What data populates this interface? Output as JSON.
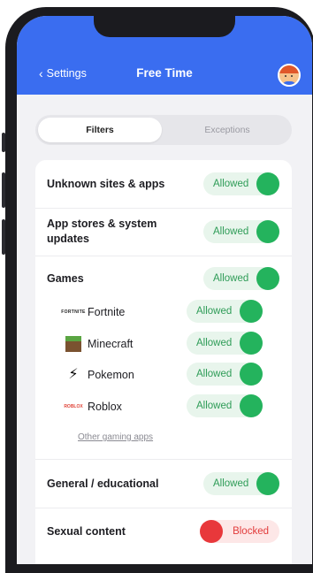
{
  "header": {
    "back_label": "Settings",
    "back_chevron": "‹",
    "title": "Free Time",
    "accent_color": "#3a6df0"
  },
  "segmented": {
    "tabs": [
      {
        "label": "Filters",
        "active": true
      },
      {
        "label": "Exceptions",
        "active": false
      }
    ]
  },
  "filters": {
    "unknown": {
      "label": "Unknown sites & apps",
      "status": "Allowed"
    },
    "appstores": {
      "label_line1": "App stores & system",
      "label_line2": "updates",
      "status": "Allowed"
    },
    "games": {
      "label": "Games",
      "status": "Allowed",
      "items": [
        {
          "name": "Fortnite",
          "icon": "fortnite-icon",
          "icon_text": "FORTNITE",
          "status": "Allowed"
        },
        {
          "name": "Minecraft",
          "icon": "minecraft-icon",
          "status": "Allowed"
        },
        {
          "name": "Pokemon",
          "icon": "pokemon-icon",
          "icon_text": "⚡",
          "status": "Allowed"
        },
        {
          "name": "Roblox",
          "icon": "roblox-icon",
          "icon_text": "ROBLOX",
          "status": "Allowed"
        }
      ],
      "other_link": "Other gaming apps"
    },
    "general": {
      "label": "General / educational",
      "status": "Allowed"
    },
    "sexual": {
      "label": "Sexual content",
      "status": "Blocked"
    }
  },
  "colors": {
    "allowed_bg": "#e8f5ec",
    "allowed_knob": "#24b35d",
    "blocked_bg": "#fde7e7",
    "blocked_knob": "#e8383b"
  }
}
